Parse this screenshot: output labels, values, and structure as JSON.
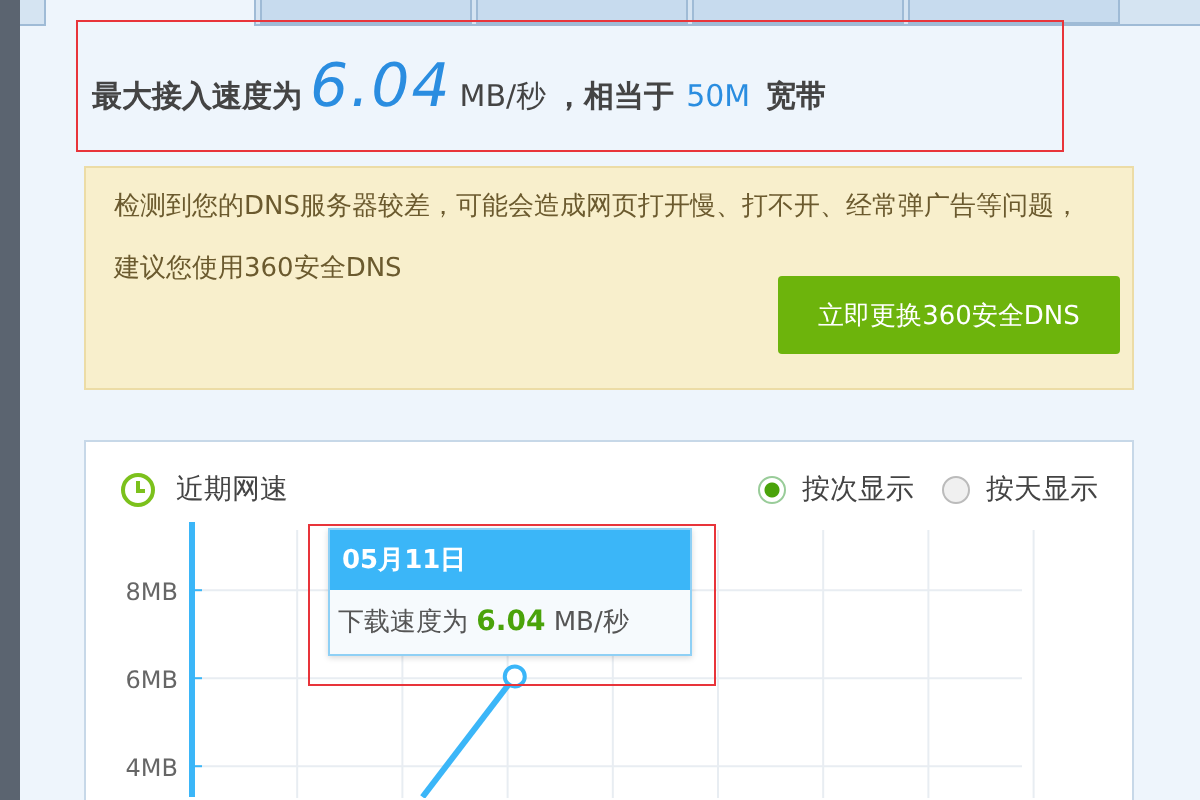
{
  "tabs": [
    {
      "selected": true
    },
    {
      "selected": false
    },
    {
      "selected": false
    },
    {
      "selected": false
    },
    {
      "selected": false
    }
  ],
  "headline": {
    "prefix": "最大接入速度为",
    "speed": "6.04",
    "unit": "MB/秒",
    "middle": "，相当于",
    "bandwidth": "50M",
    "suffix": "宽带",
    "highlighted": true
  },
  "notice": {
    "text": "检测到您的DNS服务器较差，可能会造成网页打开慢、打不开、经常弹广告等问题，建议您使用360安全DNS",
    "button": "立即更换360安全DNS"
  },
  "speed_panel": {
    "title": "近期网速",
    "view_options": [
      {
        "label": "按次显示",
        "selected": true
      },
      {
        "label": "按天显示",
        "selected": false
      }
    ],
    "tooltip": {
      "date": "05月11日",
      "label": "下载速度为",
      "value": "6.04",
      "unit": "MB/秒",
      "highlighted": true
    },
    "chart_data": {
      "type": "line",
      "grid": true,
      "ylim": [
        3.3,
        9.55
      ],
      "yticks": [
        {
          "value": 4,
          "label": "4MB"
        },
        {
          "value": 6,
          "label": "6MB"
        },
        {
          "value": 8,
          "label": "8MB"
        }
      ],
      "series": [
        {
          "color": "#3bb6f8",
          "values": [
            null,
            null,
            3.3,
            6.04,
            null,
            null,
            null,
            null,
            null
          ]
        }
      ]
    }
  }
}
